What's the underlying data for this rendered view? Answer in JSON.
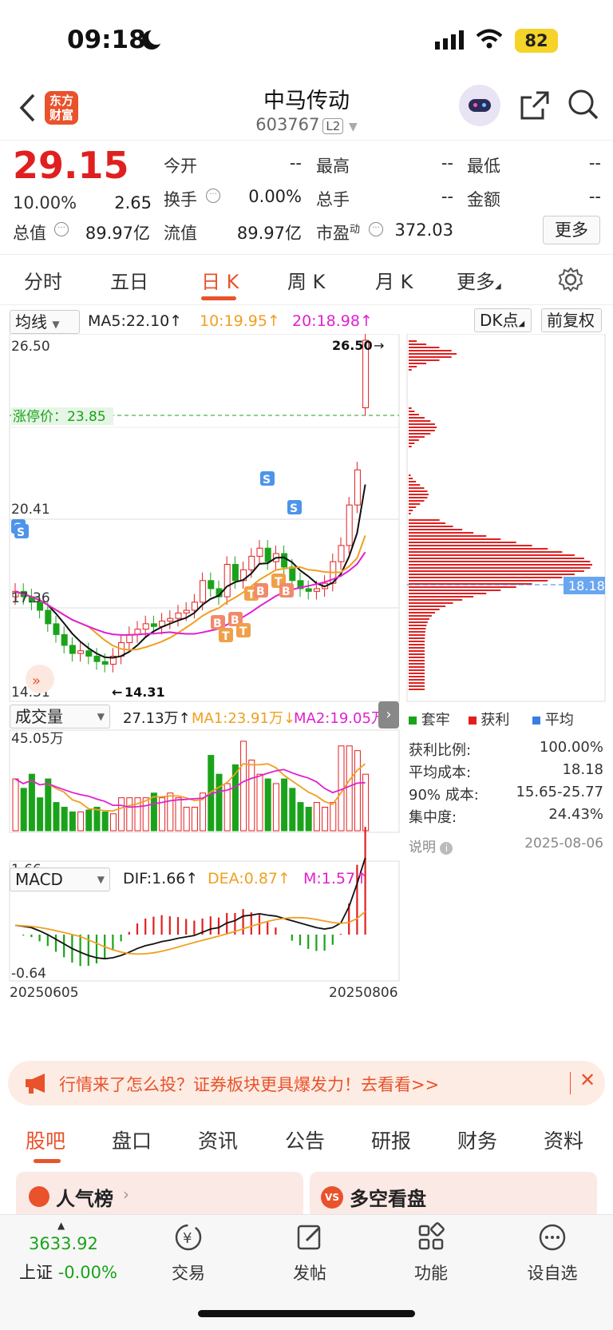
{
  "status_bar": {
    "time": "09:18",
    "battery": "82"
  },
  "header": {
    "title": "中马传动",
    "code": "603767",
    "level": "L2",
    "logo_line1": "东方",
    "logo_line2": "财富"
  },
  "quote": {
    "price": "29.15",
    "change_pct": "10.00%",
    "change": "2.65",
    "open_label": "今开",
    "open": "--",
    "high_label": "最高",
    "high": "--",
    "low_label": "最低",
    "low": "--",
    "turnover_label": "换手",
    "turnover": "0.00%",
    "volume_label": "总手",
    "volume": "--",
    "amount_label": "金额",
    "amount": "--",
    "mktcap_label": "总值",
    "mktcap": "89.97亿",
    "float_label": "流值",
    "float": "89.97亿",
    "pe_label": "市盈",
    "pe_sup": "动",
    "pe": "372.03",
    "more": "更多"
  },
  "tabs": [
    "分时",
    "五日",
    "日 K",
    "周 K",
    "月 K",
    "更多"
  ],
  "kline": {
    "ma_selector": "均线",
    "ma5": "MA5:22.10",
    "ma10": "10:19.95",
    "ma20": "20:18.98",
    "dk_button": "DK点",
    "adjust_button": "前复权",
    "y_top": "26.50",
    "y_mid1": "20.41",
    "y_mid2": "17.36",
    "y_bottom": "14.31",
    "high_marker": "26.50",
    "low_marker": "14.31",
    "limit_label": "涨停价：23.85",
    "chip_avg": "18.18"
  },
  "volume": {
    "selector": "成交量",
    "value": "27.13万",
    "ma1": "MA1:23.91万",
    "ma2": "MA2:19.05万",
    "y_top": "45.05万"
  },
  "macd": {
    "selector": "MACD",
    "dif": "DIF:1.66",
    "dea": "DEA:0.87",
    "m": "M:1.57",
    "y_top": "1.66",
    "y_bottom": "-0.64",
    "date_start": "20250605",
    "date_end": "20250806"
  },
  "chips": {
    "legend": [
      "套牢",
      "获利",
      "平均"
    ],
    "rows": [
      {
        "label": "获利比例:",
        "value": "100.00%"
      },
      {
        "label": "平均成本:",
        "value": "18.18"
      },
      {
        "label": "90% 成本:",
        "value": "15.65-25.77"
      },
      {
        "label": "集中度:",
        "value": "24.43%"
      }
    ],
    "note_label": "说明",
    "date": "2025-08-06"
  },
  "colors": {
    "up": "#e02020",
    "down": "#1aa31a",
    "accent": "#e9522b",
    "ma10": "#f0a020",
    "ma20": "#e020d0"
  },
  "banner": {
    "text": "行情来了怎么投？证券板块更具爆发力！去看看>>"
  },
  "bottom_tabs": [
    "股吧",
    "盘口",
    "资讯",
    "公告",
    "研报",
    "财务",
    "资料"
  ],
  "cards": [
    "人气榜",
    "多空看盘"
  ],
  "nav": {
    "index_value": "3633.92",
    "index_name": "上证",
    "index_change": "-0.00%",
    "items": [
      "交易",
      "发帖",
      "功能",
      "设自选"
    ]
  }
}
